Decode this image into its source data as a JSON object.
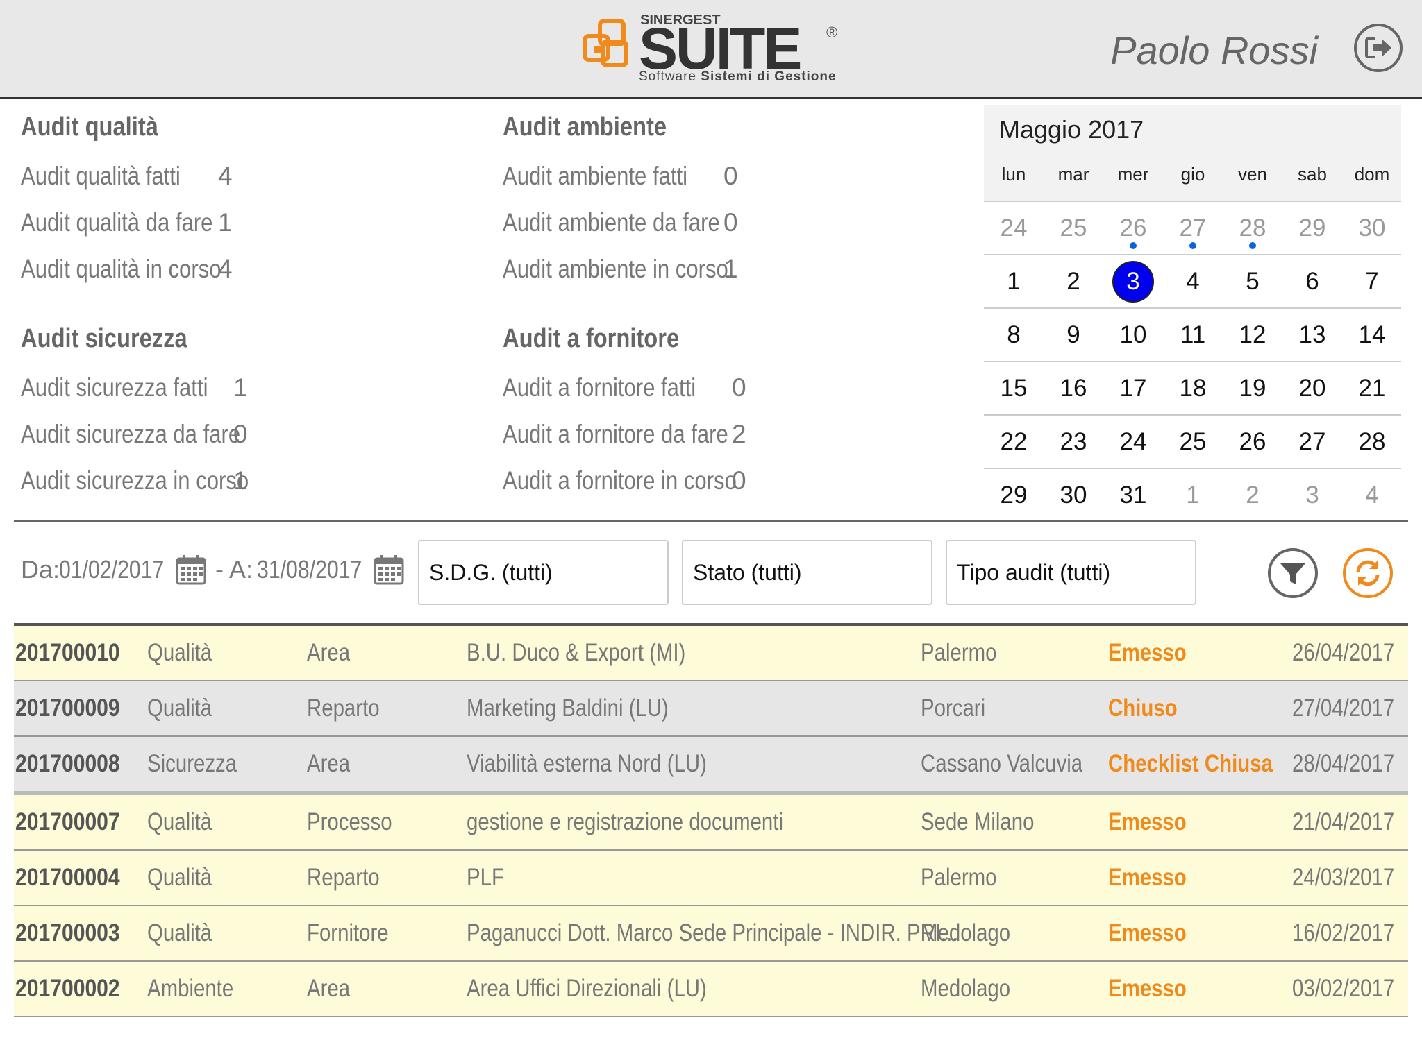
{
  "header": {
    "brand_small": "SINERGEST",
    "brand": "SUITE",
    "registered": "®",
    "tagline_prefix": "Software ",
    "tagline_bold": "Sistemi di Gestione",
    "user": "Paolo Rossi",
    "logout_icon": "logout-icon"
  },
  "stats": {
    "qualita": {
      "title": "Audit qualità",
      "rows": [
        {
          "label": "Audit qualità fatti",
          "value": "4"
        },
        {
          "label": "Audit qualità da fare",
          "value": "1"
        },
        {
          "label": "Audit qualità in corso",
          "value": "4"
        }
      ]
    },
    "ambiente": {
      "title": "Audit ambiente",
      "rows": [
        {
          "label": "Audit ambiente fatti",
          "value": "0"
        },
        {
          "label": "Audit ambiente da fare",
          "value": "0"
        },
        {
          "label": "Audit ambiente in corso",
          "value": "1"
        }
      ]
    },
    "sicurezza": {
      "title": "Audit sicurezza",
      "rows": [
        {
          "label": "Audit sicurezza fatti",
          "value": "1"
        },
        {
          "label": "Audit sicurezza da fare",
          "value": "0"
        },
        {
          "label": "Audit sicurezza in corso",
          "value": "1"
        }
      ]
    },
    "fornitore": {
      "title": "Audit a fornitore",
      "rows": [
        {
          "label": "Audit a fornitore fatti",
          "value": "0"
        },
        {
          "label": "Audit a fornitore da fare",
          "value": "2"
        },
        {
          "label": "Audit a fornitore in corso",
          "value": "0"
        }
      ]
    }
  },
  "calendar": {
    "title": "Maggio 2017",
    "weekdays": [
      "lun",
      "mar",
      "mer",
      "gio",
      "ven",
      "sab",
      "dom"
    ],
    "weeks": [
      [
        "24",
        "25",
        "26",
        "27",
        "28",
        "29",
        "30"
      ],
      [
        "1",
        "2",
        "3",
        "4",
        "5",
        "6",
        "7"
      ],
      [
        "8",
        "9",
        "10",
        "11",
        "12",
        "13",
        "14"
      ],
      [
        "15",
        "16",
        "17",
        "18",
        "19",
        "20",
        "21"
      ],
      [
        "22",
        "23",
        "24",
        "25",
        "26",
        "27",
        "28"
      ],
      [
        "29",
        "30",
        "31",
        "1",
        "2",
        "3",
        "4"
      ]
    ],
    "selected_day": "3",
    "event_days": [
      "26 apr",
      "27 apr",
      "28 apr"
    ],
    "accent_color": "#0000ee",
    "dot_color": "#0a63e0"
  },
  "filters": {
    "from_label": "Da:",
    "from_date": "01/02/2017",
    "to_label": "- A:",
    "to_date": "31/08/2017",
    "sdg": "S.D.G. (tutti)",
    "stato": "Stato (tutti)",
    "tipo": "Tipo audit (tutti)",
    "filter_icon": "filter-icon",
    "refresh_icon": "refresh-icon",
    "refresh_color": "#f08a1c"
  },
  "audits": [
    {
      "id": "201700010",
      "tipo": "Qualità",
      "ambito": "Area",
      "descrizione": "B.U. Duco & Export (MI)",
      "sede": "Palermo",
      "stato": "Emesso",
      "data": "26/04/2017"
    },
    {
      "id": "201700009",
      "tipo": "Qualità",
      "ambito": "Reparto",
      "descrizione": "Marketing Baldini (LU)",
      "sede": "Porcari",
      "stato": "Chiuso",
      "data": "27/04/2017"
    },
    {
      "id": "201700008",
      "tipo": "Sicurezza",
      "ambito": "Area",
      "descrizione": "Viabilità esterna Nord (LU)",
      "sede": "Cassano Valcuvia",
      "stato": "Checklist Chiusa",
      "data": "28/04/2017"
    },
    {
      "id": "201700007",
      "tipo": "Qualità",
      "ambito": "Processo",
      "descrizione": "gestione e registrazione documenti",
      "sede": "Sede Milano",
      "stato": "Emesso",
      "data": "21/04/2017"
    },
    {
      "id": "201700004",
      "tipo": "Qualità",
      "ambito": "Reparto",
      "descrizione": "PLF",
      "sede": "Palermo",
      "stato": "Emesso",
      "data": "24/03/2017"
    },
    {
      "id": "201700003",
      "tipo": "Qualità",
      "ambito": "Fornitore",
      "descrizione": "Paganucci Dott. Marco  Sede Principale - INDIR. PRI...",
      "sede": "Medolago",
      "stato": "Emesso",
      "data": "16/02/2017"
    },
    {
      "id": "201700002",
      "tipo": "Ambiente",
      "ambito": "Area",
      "descrizione": "Area Uffici Direzionali (LU)",
      "sede": "Medolago",
      "stato": "Emesso",
      "data": "03/02/2017"
    }
  ],
  "status_color": "#f08a1c"
}
